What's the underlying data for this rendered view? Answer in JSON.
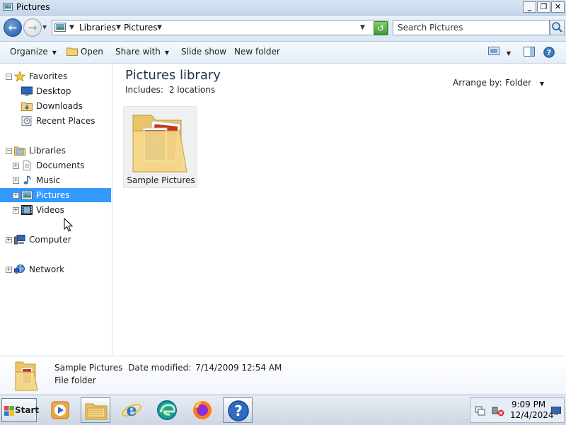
{
  "window": {
    "title": "Pictures",
    "controls": {
      "minimize": "_",
      "restore": "❐",
      "close": "✕"
    }
  },
  "address": {
    "breadcrumbs": [
      "Libraries",
      "Pictures"
    ],
    "search_placeholder": "Search Pictures"
  },
  "toolbar": {
    "organize": "Organize",
    "open": "Open",
    "share_with": "Share with",
    "slide_show": "Slide show",
    "new_folder": "New folder"
  },
  "nav": {
    "favorites": {
      "label": "Favorites",
      "items": [
        "Desktop",
        "Downloads",
        "Recent Places"
      ]
    },
    "libraries": {
      "label": "Libraries",
      "items": [
        "Documents",
        "Music",
        "Pictures",
        "Videos"
      ],
      "selected": "Pictures"
    },
    "computer": "Computer",
    "network": "Network"
  },
  "content": {
    "title": "Pictures library",
    "includes_label": "Includes:",
    "includes_value": "2 locations",
    "arrange_by_label": "Arrange by:",
    "arrange_by_value": "Folder",
    "items": [
      {
        "name": "Sample Pictures",
        "type": "folder"
      }
    ]
  },
  "details": {
    "name": "Sample Pictures",
    "date_label": "Date modified:",
    "date_value": "7/14/2009 12:54 AM",
    "type": "File folder"
  },
  "taskbar": {
    "start_label": "Start",
    "time": "9:09 PM",
    "date": "12/4/2024",
    "pinned_icons": [
      "media-player-icon",
      "explorer-icon",
      "ie-icon",
      "edge-icon",
      "firefox-icon",
      "help-icon"
    ]
  },
  "colors": {
    "selection": "#3399ff",
    "accent": "#1e5aa5"
  }
}
